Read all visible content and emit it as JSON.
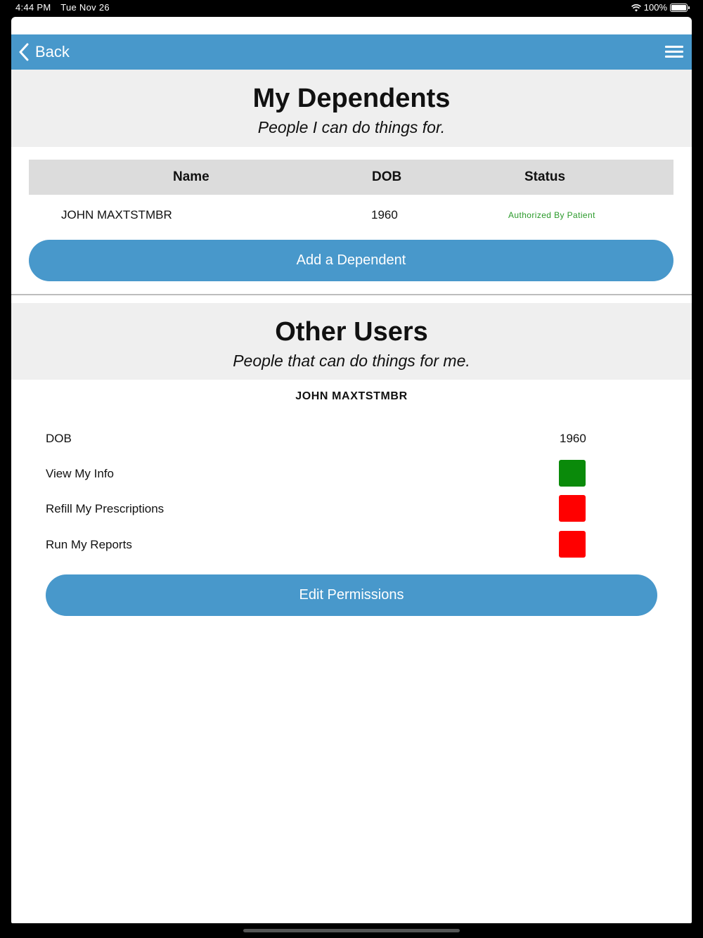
{
  "status_bar": {
    "time": "4:44 PM",
    "date": "Tue Nov 26",
    "battery": "100%"
  },
  "nav": {
    "back_label": "Back",
    "menu_icon": "hamburger-menu-icon"
  },
  "colors": {
    "accent": "#4898cb",
    "header_bg": "#efefef",
    "granted": "#0a8a0a",
    "denied": "#ff0000",
    "status_text": "#2a9a2a"
  },
  "dependents": {
    "title": "My Dependents",
    "subtitle": "People I can do things for.",
    "columns": [
      "Name",
      "DOB",
      "Status"
    ],
    "rows": [
      {
        "name": "JOHN MAXTSTMBR",
        "dob": "1960",
        "status": "Authorized By Patient"
      }
    ],
    "add_button": "Add a Dependent"
  },
  "other_users": {
    "title": "Other Users",
    "subtitle": "People that can do things for me.",
    "user_name": "JOHN MAXTSTMBR",
    "dob_label": "DOB",
    "dob_value": "1960",
    "permissions": [
      {
        "label": "View My Info",
        "granted": true
      },
      {
        "label": "Refill My Prescriptions",
        "granted": false
      },
      {
        "label": "Run My Reports",
        "granted": false
      }
    ],
    "edit_button": "Edit Permissions"
  }
}
